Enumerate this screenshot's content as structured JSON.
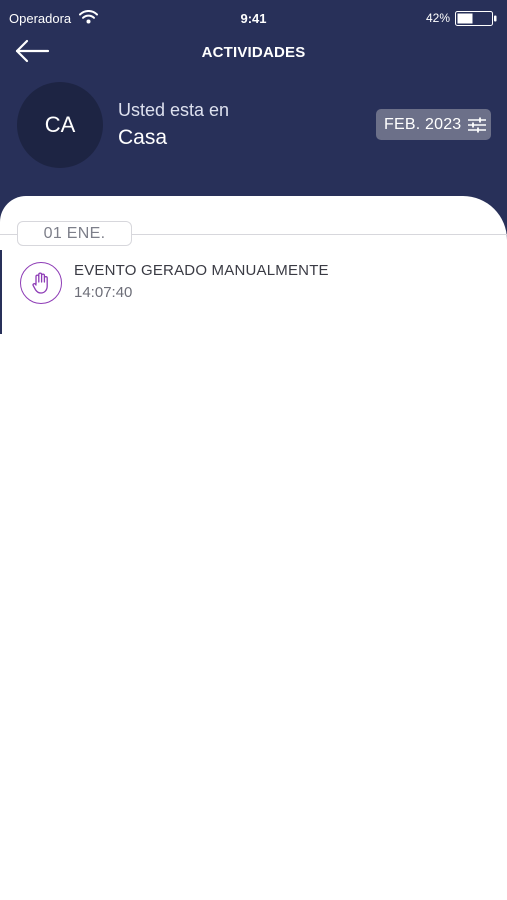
{
  "status_bar": {
    "carrier": "Operadora",
    "time": "9:41",
    "battery": "42%"
  },
  "nav": {
    "title": "ACTIVIDADES",
    "back_icon": "arrow-left-icon"
  },
  "location": {
    "avatar_initials": "CA",
    "caption": "Usted esta en",
    "name": "Casa"
  },
  "filter": {
    "label": "FEB. 2023",
    "icon": "sliders-icon"
  },
  "timeline": {
    "date_label": "01 ENE.",
    "events": [
      {
        "title": "EVENTO GERADO MANUALMENTE",
        "time": "14:07:40",
        "icon": "hand-icon"
      }
    ]
  },
  "colors": {
    "header_bg": "#283059",
    "avatar_bg": "#1d2443",
    "event_accent": "#8e3cb6"
  }
}
